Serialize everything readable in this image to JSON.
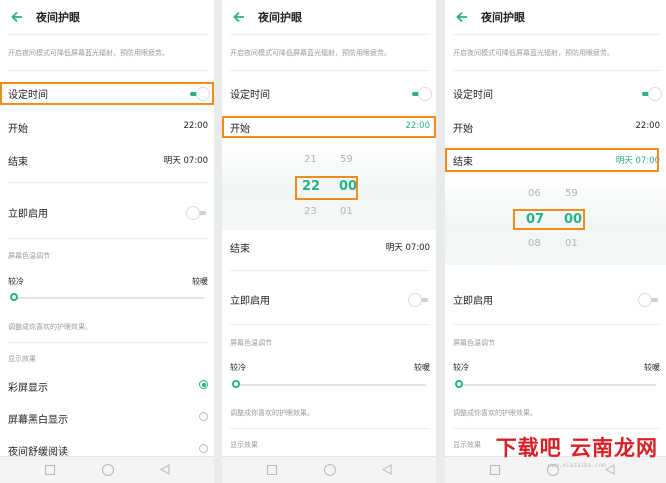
{
  "colors": {
    "accent": "#27b08a",
    "highlight": "#f08c1a",
    "watermark": "#d71f26"
  },
  "common": {
    "title": "夜间护眼",
    "description": "开启夜间模式可降低屏幕蓝光辐射，预防用眼疲劳。",
    "set_time": "设定时间",
    "start": "开始",
    "end": "结束",
    "enable_now": "立即启用",
    "color_temp_section": "屏幕色温调节",
    "cooler": "较冷",
    "warmer": "较暖",
    "adjust_hint": "调整成你喜欢的护眼效果。",
    "display_section": "显示效果",
    "color_display": "彩屏显示",
    "bw_display": "屏幕黑白显示",
    "night_reading": "夜间舒缓阅读",
    "start_value": "22:00",
    "end_value": "明天 07:00",
    "set_time_on": true,
    "enable_now_on": false,
    "color_temp_level": 0
  },
  "panel2_picker": {
    "hour_prev": "21",
    "hour": "22",
    "hour_next": "23",
    "min_prev": "59",
    "min": "00",
    "min_next": "01"
  },
  "panel3_picker": {
    "hour_prev": "06",
    "hour": "07",
    "hour_next": "08",
    "min_prev": "59",
    "min": "00",
    "min_next": "01"
  },
  "watermark": {
    "text": "下载吧 云南龙网",
    "url": "www.xiazaiba.com"
  },
  "icons": {
    "back": "arrow-left-icon",
    "nav_recent": "square-icon",
    "nav_home": "circle-icon",
    "nav_back": "triangle-left-icon"
  }
}
